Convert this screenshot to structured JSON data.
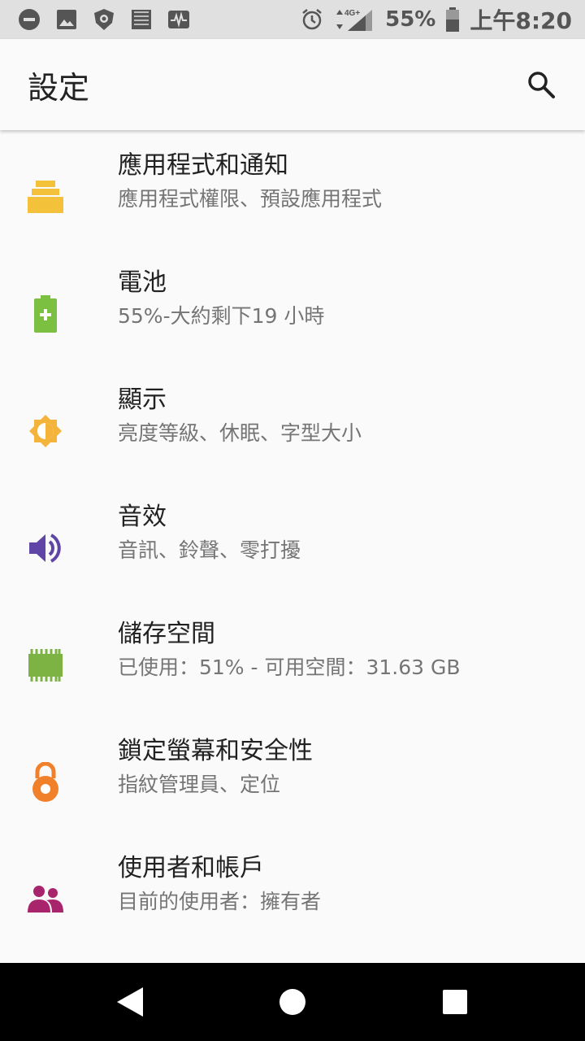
{
  "status_bar": {
    "icons_left": [
      "dnd-icon",
      "image-icon",
      "shield-icon",
      "sim-icon",
      "activity-icon"
    ],
    "network": "4G+",
    "battery_percent": "55%",
    "time": "上午8:20"
  },
  "app_bar": {
    "title": "設定",
    "search_icon": "search-icon"
  },
  "settings": [
    {
      "title": "應用程式和通知",
      "subtitle": "應用程式權限、預設應用程式",
      "icon": "apps-icon",
      "color": "#f4c13b"
    },
    {
      "title": "電池",
      "subtitle": "55%-大約剩下19 小時",
      "icon": "battery-icon",
      "color": "#7cc042"
    },
    {
      "title": "顯示",
      "subtitle": "亮度等級、休眠、字型大小",
      "icon": "brightness-icon",
      "color": "#f4b43b"
    },
    {
      "title": "音效",
      "subtitle": "音訊、鈴聲、零打擾",
      "icon": "volume-icon",
      "color": "#5e45a6"
    },
    {
      "title": "儲存空間",
      "subtitle": "已使用：51% - 可用空間：31.63 GB",
      "icon": "storage-icon",
      "color": "#7cb342"
    },
    {
      "title": "鎖定螢幕和安全性",
      "subtitle": "指紋管理員、定位",
      "icon": "lock-icon",
      "color": "#f0812a"
    },
    {
      "title": "使用者和帳戶",
      "subtitle": "目前的使用者：擁有者",
      "icon": "accounts-icon",
      "color": "#a8256b"
    }
  ],
  "nav_bar": {
    "back": "back-icon",
    "home": "home-icon",
    "recents": "recents-icon"
  }
}
